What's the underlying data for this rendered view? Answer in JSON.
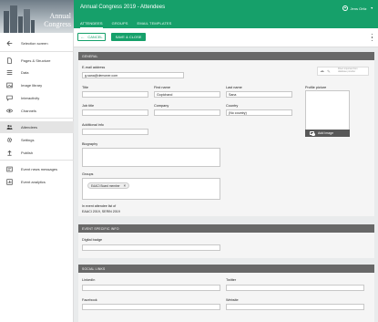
{
  "app": {
    "title": "Annual Congress 2019 - Attendees",
    "user": "Jens Ortiz"
  },
  "brand": {
    "banner_line1": "Annual",
    "banner_line2": "Congress",
    "accent": "#16a06a"
  },
  "sidebar": {
    "items": [
      {
        "label": "Selection screen",
        "icon": "arrow-left-icon"
      },
      {
        "label": "Pages & Structure",
        "icon": "page-icon"
      },
      {
        "label": "Data",
        "icon": "list-icon"
      },
      {
        "label": "Image library",
        "icon": "image-icon"
      },
      {
        "label": "Interactivity",
        "icon": "chat-icon"
      },
      {
        "label": "Channels",
        "icon": "eye-icon"
      },
      {
        "label": "Attendees",
        "icon": "people-icon"
      },
      {
        "label": "Settings",
        "icon": "gear-icon"
      },
      {
        "label": "Publish",
        "icon": "upload-icon"
      },
      {
        "label": "Event news messages",
        "icon": "news-icon"
      },
      {
        "label": "Event analytics",
        "icon": "analytics-icon"
      }
    ]
  },
  "tabs": [
    {
      "label": "ATTENDEES",
      "active": true
    },
    {
      "label": "GROUPS",
      "active": false
    },
    {
      "label": "EMAIL TEMPLATES",
      "active": false
    }
  ],
  "toolbar": {
    "cancel_label": "CANCEL",
    "save_label": "SAVE & CLOSE"
  },
  "general": {
    "header": "GENERAL",
    "email_label": "E-mail address",
    "email_value": "g.sana@demoner.com",
    "import_text_1": "Direct imported from",
    "import_text_2": "database provider",
    "title_label": "Title",
    "title_value": "",
    "firstname_label": "First name",
    "firstname_value": "Gopichand",
    "lastname_label": "Last name",
    "lastname_value": "Sana",
    "picture_label": "Profile picture",
    "add_image_label": "Add image",
    "jobtitle_label": "Job title",
    "jobtitle_value": "",
    "company_label": "Company",
    "company_value": "",
    "country_label": "Country",
    "country_value": "(No country)",
    "addinfo_label": "Additional info",
    "addinfo_value": "",
    "bio_label": "Biography",
    "groups_label": "Groups",
    "group_chip": "EAACI Board member",
    "inevent_label": "In event attendee list of",
    "inevent_value": "EAACI 2019, SERIN 2019"
  },
  "event_info": {
    "header": "EVENT SPECIFIC INFO",
    "badge_label": "Digital badge",
    "badge_value": ""
  },
  "social": {
    "header": "SOCIAL LINKS",
    "linkedin_label": "LinkedIn",
    "twitter_label": "Twitter",
    "facebook_label": "Facebook",
    "website_label": "Website"
  }
}
